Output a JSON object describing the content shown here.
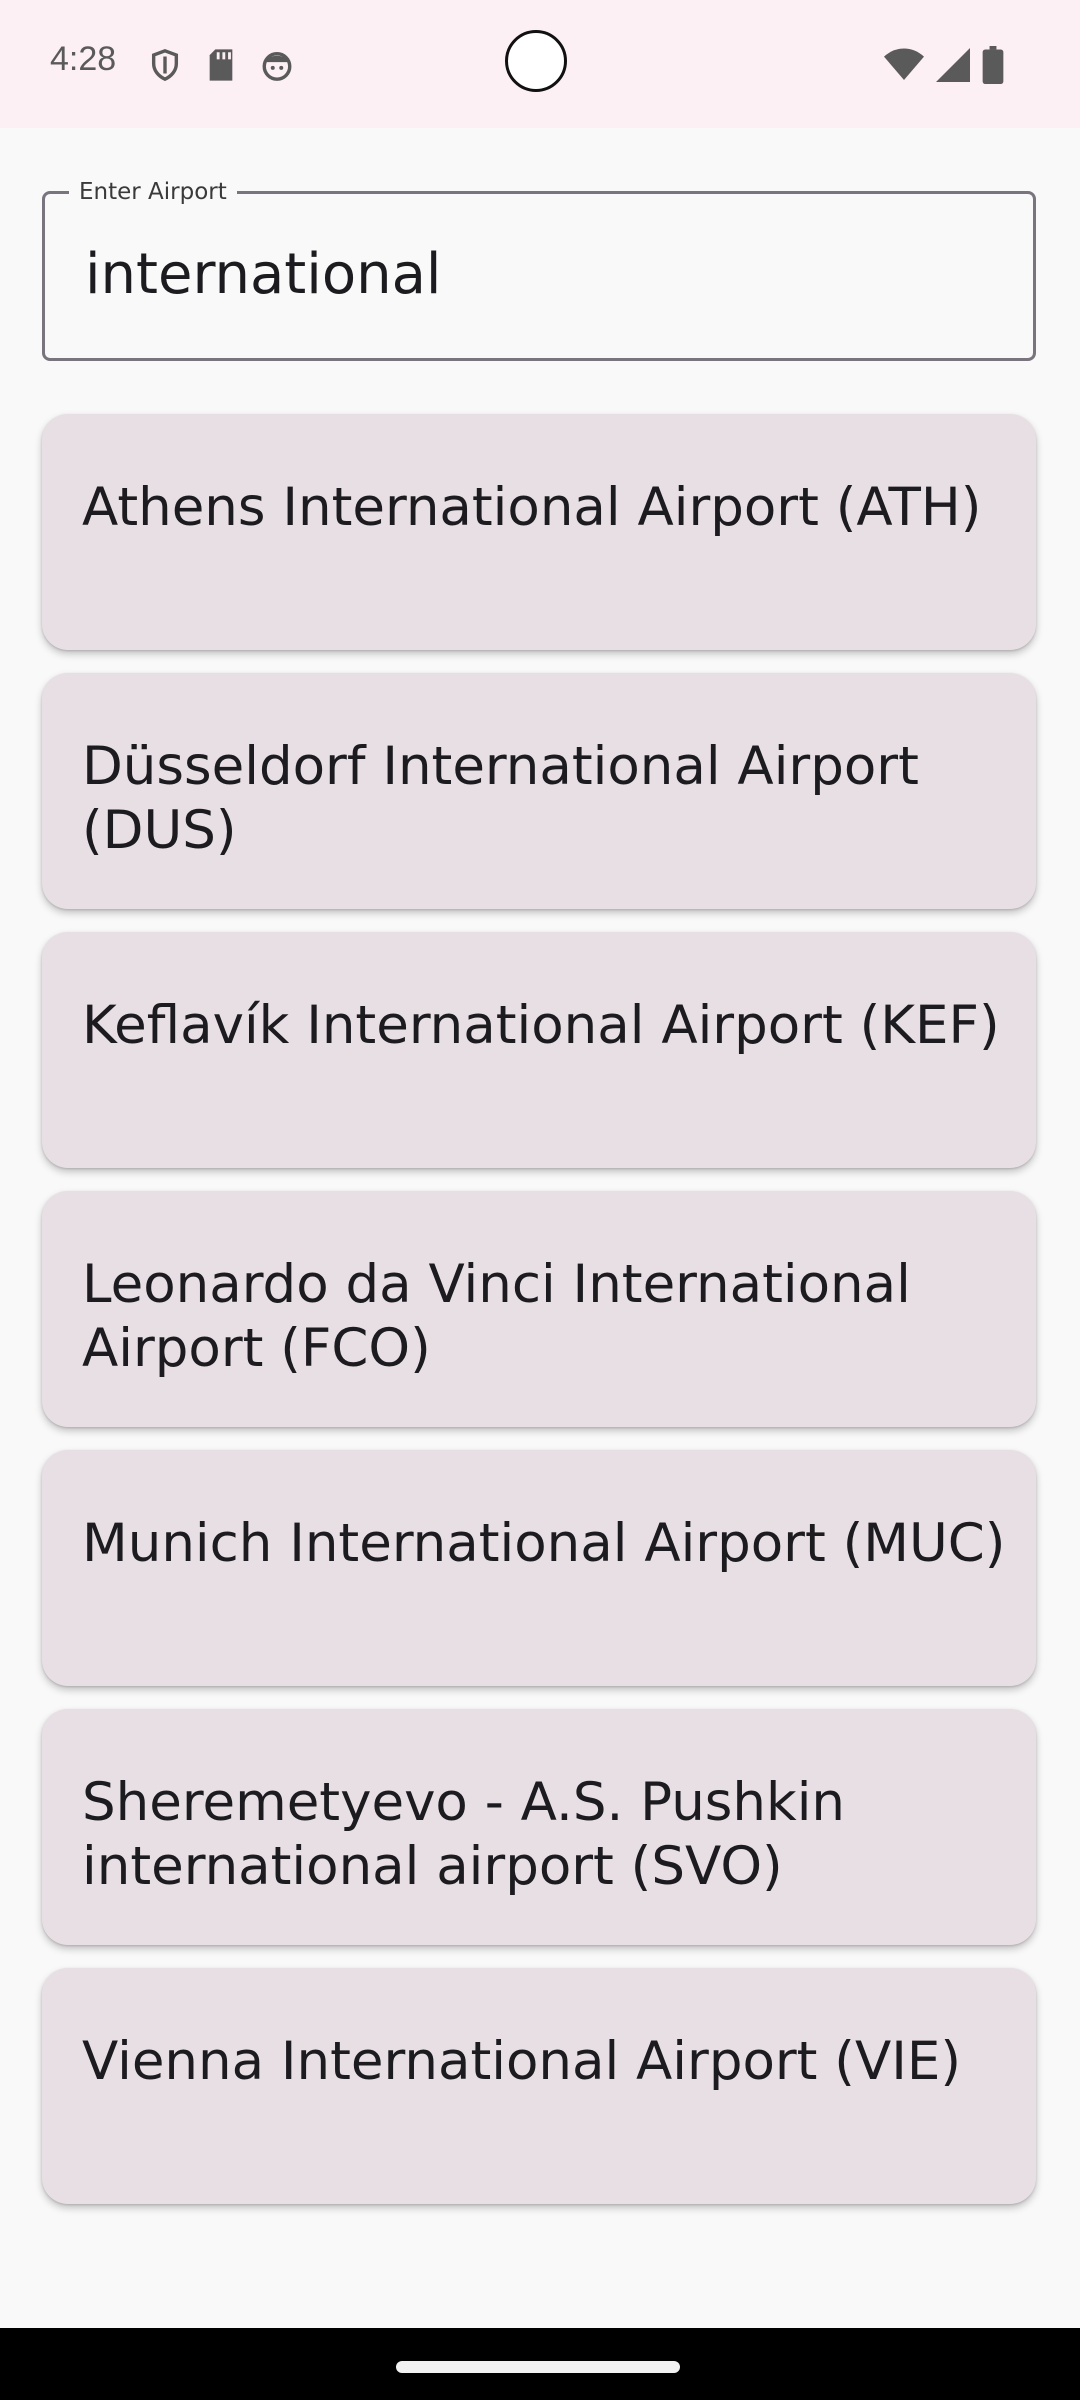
{
  "status_bar": {
    "time": "4:28",
    "left_icons": [
      "shield-icon",
      "sd-card-icon",
      "face-icon"
    ],
    "right_icons": [
      "wifi-icon",
      "signal-icon",
      "battery-icon"
    ]
  },
  "search": {
    "label": "Enter Airport",
    "value": "international"
  },
  "results": [
    {
      "name": "Athens International Airport (ATH)"
    },
    {
      "name": "Düsseldorf International Airport (DUS)"
    },
    {
      "name": "Keflavík International Airport (KEF)"
    },
    {
      "name": "Leonardo da Vinci International Airport (FCO)"
    },
    {
      "name": "Munich International Airport (MUC)"
    },
    {
      "name": "Sheremetyevo - A.S. Pushkin international airport (SVO)"
    },
    {
      "name": "Vienna International Airport (VIE)"
    }
  ],
  "colors": {
    "status_bar_bg": "#fdf0f5",
    "card_bg": "#e8dfe4",
    "field_border": "#79747e",
    "text": "#1c1b1f"
  }
}
